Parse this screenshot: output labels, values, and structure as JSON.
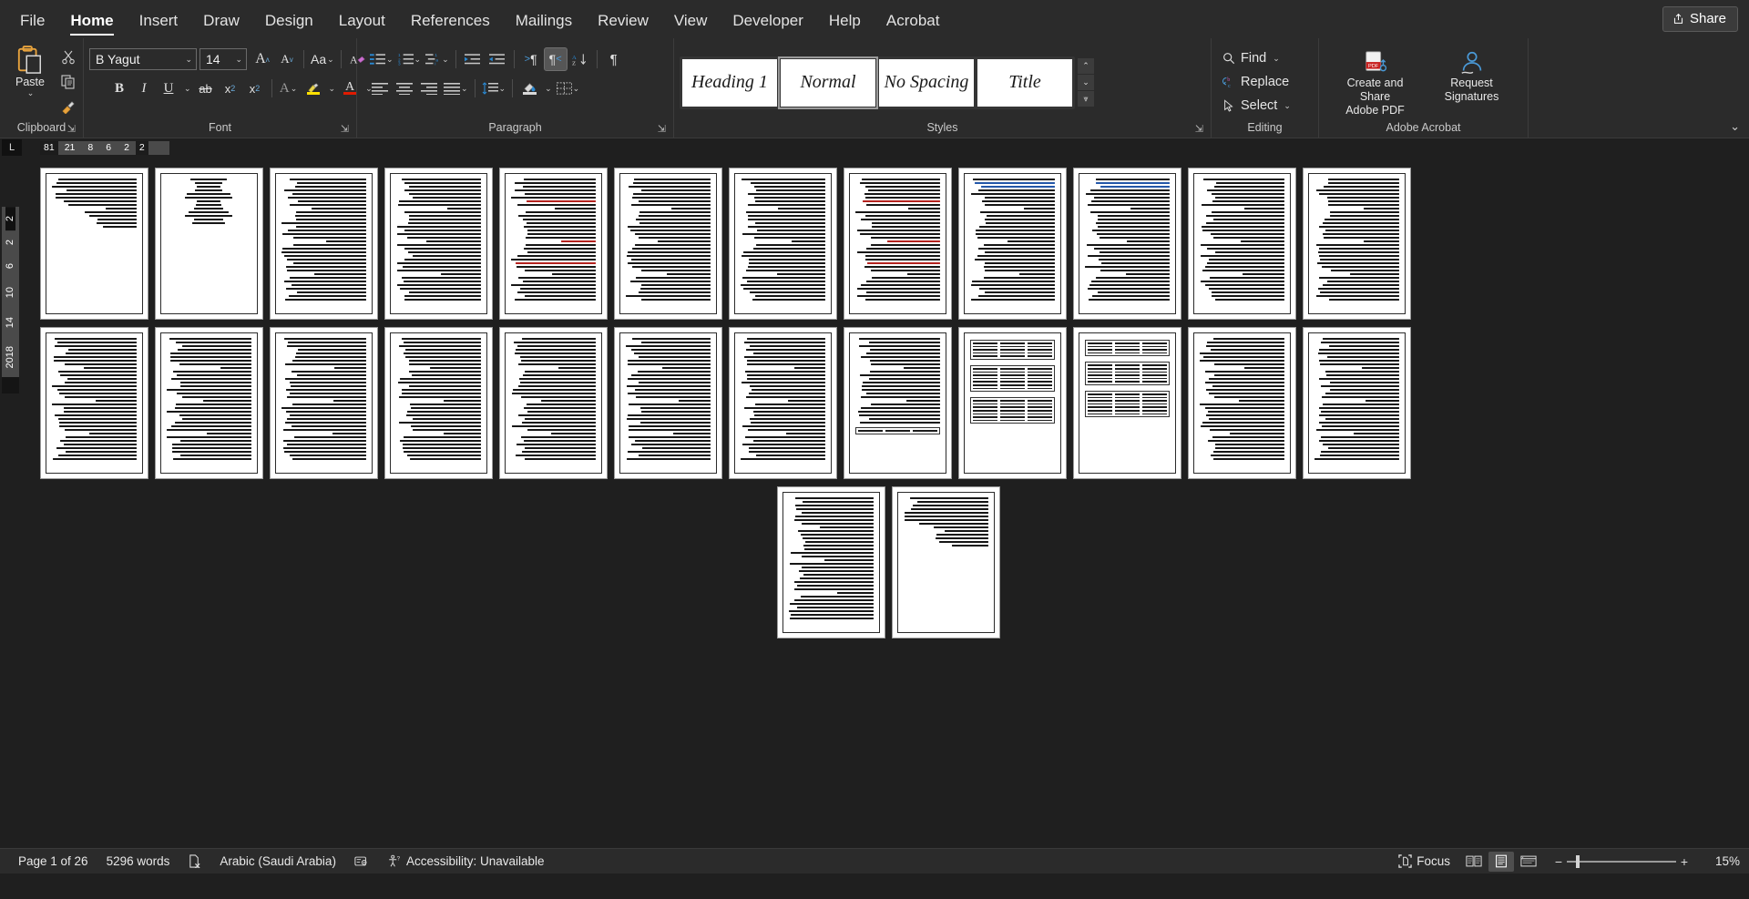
{
  "app": {
    "tabs": [
      {
        "label": "File",
        "active": false
      },
      {
        "label": "Home",
        "active": true
      },
      {
        "label": "Insert",
        "active": false
      },
      {
        "label": "Draw",
        "active": false
      },
      {
        "label": "Design",
        "active": false
      },
      {
        "label": "Layout",
        "active": false
      },
      {
        "label": "References",
        "active": false
      },
      {
        "label": "Mailings",
        "active": false
      },
      {
        "label": "Review",
        "active": false
      },
      {
        "label": "View",
        "active": false
      },
      {
        "label": "Developer",
        "active": false
      },
      {
        "label": "Help",
        "active": false
      },
      {
        "label": "Acrobat",
        "active": false
      }
    ],
    "share_label": "Share",
    "share_icon": "share-icon"
  },
  "ribbon": {
    "collapse_icon": "chevron-up-icon",
    "clipboard": {
      "label": "Clipboard",
      "dialog_launcher": "dialog-launcher-icon",
      "paste_label": "Paste",
      "paste_icon": "paste-icon",
      "paste_caret": "chevron-down-icon",
      "cut_icon": "scissors-icon",
      "copy_icon": "copy-icon",
      "format_painter_icon": "format-painter-icon"
    },
    "font": {
      "label": "Font",
      "dialog_launcher": "dialog-launcher-icon",
      "font_name": "B Yagut",
      "font_size": "14",
      "grow_font_icon": "grow-font-icon",
      "shrink_font_icon": "shrink-font-icon",
      "change_case_icon": "change-case-icon",
      "clear_formatting_icon": "clear-formatting-icon",
      "bold_icon": "bold-icon",
      "italic_icon": "italic-icon",
      "underline_icon": "underline-icon",
      "strikethrough_icon": "strikethrough-icon",
      "subscript_icon": "subscript-icon",
      "superscript_icon": "superscript-icon",
      "text_effects_icon": "text-effects-icon",
      "highlight_icon": "text-highlight-icon",
      "font_color_icon": "font-color-icon",
      "highlight_color": "#ffe100",
      "font_color": "#e01b00"
    },
    "paragraph": {
      "label": "Paragraph",
      "dialog_launcher": "dialog-launcher-icon",
      "bullets_icon": "bullets-icon",
      "numbering_icon": "numbering-icon",
      "multilevel_icon": "multilevel-list-icon",
      "increase_indent_icon": "increase-indent-icon",
      "decrease_indent_icon": "decrease-indent-icon",
      "ltr_icon": "left-to-right-icon",
      "rtl_icon": "right-to-left-icon",
      "sort_icon": "sort-icon",
      "show_marks_icon": "show-formatting-marks-icon",
      "align_left_icon": "align-left-icon",
      "align_center_icon": "align-center-icon",
      "align_right_icon": "align-right-icon",
      "justify_icon": "justify-icon",
      "line_spacing_icon": "line-spacing-icon",
      "shading_icon": "shading-icon",
      "borders_icon": "borders-icon",
      "rtl_active": true
    },
    "styles": {
      "label": "Styles",
      "dialog_launcher": "dialog-launcher-icon",
      "gallery": [
        {
          "name": "Heading 1",
          "selected": false
        },
        {
          "name": "Normal",
          "selected": true
        },
        {
          "name": "No Spacing",
          "selected": false
        },
        {
          "name": "Title",
          "selected": false
        }
      ],
      "scroll_up_icon": "chevron-up-icon",
      "scroll_down_icon": "chevron-down-icon",
      "more_icon": "more-styles-icon"
    },
    "editing": {
      "label": "Editing",
      "items": [
        {
          "label": "Find",
          "icon": "search-icon",
          "caret": true
        },
        {
          "label": "Replace",
          "icon": "replace-icon",
          "caret": false
        },
        {
          "label": "Select",
          "icon": "cursor-arrow-icon",
          "caret": true
        }
      ]
    },
    "adobe": {
      "label": "Adobe Acrobat",
      "buttons": [
        {
          "line1": "Create and Share",
          "line2": "Adobe PDF",
          "icon": "adobe-pdf-icon"
        },
        {
          "line1": "Request",
          "line2": "Signatures",
          "icon": "request-signatures-icon"
        }
      ]
    }
  },
  "rulers": {
    "tab_selector_icon": "left-tab-stop-icon",
    "horizontal_marks": [
      "81",
      "21",
      "8",
      "6",
      "2",
      "2"
    ],
    "vertical_marks": [
      "2",
      "2",
      "6",
      "10",
      "14",
      "2018"
    ]
  },
  "document": {
    "page_rows": [
      {
        "count": 12,
        "variant": "text"
      },
      {
        "count": 12,
        "variant": "text"
      },
      {
        "count": 2,
        "variant": "text"
      }
    ],
    "pages": [
      {
        "index": 1,
        "kind": "text-short"
      },
      {
        "index": 2,
        "kind": "centered-short"
      },
      {
        "index": 3,
        "kind": "text"
      },
      {
        "index": 4,
        "kind": "text"
      },
      {
        "index": 5,
        "kind": "text-red"
      },
      {
        "index": 6,
        "kind": "text"
      },
      {
        "index": 7,
        "kind": "text"
      },
      {
        "index": 8,
        "kind": "text-red"
      },
      {
        "index": 9,
        "kind": "text-blue"
      },
      {
        "index": 10,
        "kind": "text-blue"
      },
      {
        "index": 11,
        "kind": "text"
      },
      {
        "index": 12,
        "kind": "text"
      },
      {
        "index": 13,
        "kind": "text"
      },
      {
        "index": 14,
        "kind": "text"
      },
      {
        "index": 15,
        "kind": "text"
      },
      {
        "index": 16,
        "kind": "text"
      },
      {
        "index": 17,
        "kind": "text"
      },
      {
        "index": 18,
        "kind": "text"
      },
      {
        "index": 19,
        "kind": "text"
      },
      {
        "index": 20,
        "kind": "text-box"
      },
      {
        "index": 21,
        "kind": "table"
      },
      {
        "index": 22,
        "kind": "table"
      },
      {
        "index": 23,
        "kind": "text"
      },
      {
        "index": 24,
        "kind": "text"
      },
      {
        "index": 25,
        "kind": "text"
      },
      {
        "index": 26,
        "kind": "text-short"
      }
    ]
  },
  "status": {
    "page_indicator": "Page 1 of 26",
    "word_count": "5296 words",
    "proofing_icon": "proofing-errors-icon",
    "language": "Arabic (Saudi Arabia)",
    "dictation_icon": "dictate-icon",
    "accessibility_icon": "accessibility-icon",
    "accessibility": "Accessibility: Unavailable",
    "focus_label": "Focus",
    "focus_icon": "focus-mode-icon",
    "views": [
      {
        "name": "read-mode",
        "icon": "read-mode-icon",
        "active": false
      },
      {
        "name": "print-layout",
        "icon": "print-layout-icon",
        "active": true
      },
      {
        "name": "web-layout",
        "icon": "web-layout-icon",
        "active": false
      }
    ],
    "zoom_out_icon": "minus-icon",
    "zoom_in_icon": "plus-icon",
    "zoom_level": "15%",
    "zoom_slider_value": 15
  }
}
